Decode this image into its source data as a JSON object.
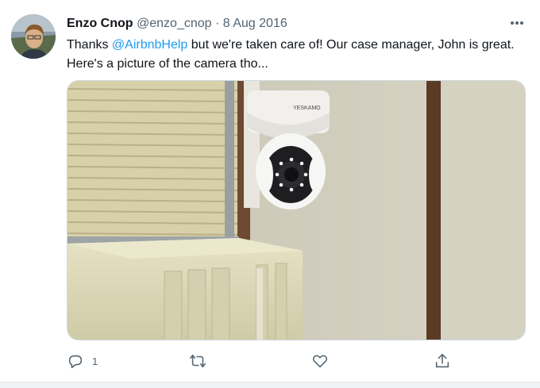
{
  "tweet": {
    "author_name": "Enzo Cnop",
    "handle": "@enzo_cnop",
    "separator": "·",
    "date": "8 Aug 2016",
    "text_before": "Thanks ",
    "mention": "@AirbnbHelp",
    "text_after": " but we're taken care of! Our case manager, John is great. Here's a picture of the camera tho...",
    "camera_brand": "YESKAMO"
  },
  "actions": {
    "reply_count": "1"
  },
  "colors": {
    "accent": "#1d9bf0",
    "secondary_text": "#536471",
    "border": "#cfd9de"
  },
  "icons": [
    "more-icon",
    "reply-icon",
    "retweet-icon",
    "like-icon",
    "share-icon"
  ]
}
